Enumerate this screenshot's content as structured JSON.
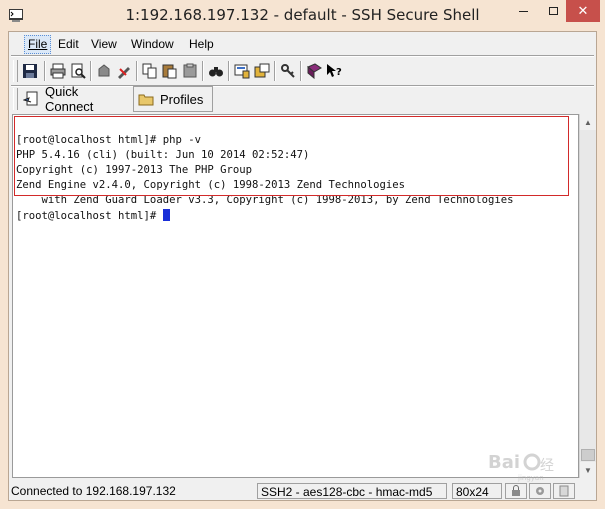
{
  "window": {
    "title": "1:192.168.197.132 - default - SSH Secure Shell",
    "app_icon": "ssh-shell-icon"
  },
  "menu": {
    "file": "File",
    "edit": "Edit",
    "view": "View",
    "window": "Window",
    "help": "Help"
  },
  "toolbar": {
    "icons": [
      "save-icon",
      "print-icon",
      "print-preview-icon",
      "disconnect-icon",
      "new-connection-icon",
      "copy-icon",
      "paste-icon",
      "paste-icon-2",
      "find-icon",
      "settings-icon",
      "sftp-icon",
      "keys-icon",
      "help-book-icon",
      "context-help-icon"
    ]
  },
  "quickbar": {
    "quick_connect": "Quick Connect",
    "profiles": "Profiles"
  },
  "terminal": {
    "lines": [
      "[root@localhost html]# php -v",
      "PHP 5.4.16 (cli) (built: Jun 10 2014 02:52:47)",
      "Copyright (c) 1997-2013 The PHP Group",
      "Zend Engine v2.4.0, Copyright (c) 1998-2013 Zend Technologies",
      "    with Zend Guard Loader v3.3, Copyright (c) 1998-2013, by Zend Technologies"
    ],
    "prompt": "[root@localhost html]# "
  },
  "status": {
    "connection": "Connected to 192.168.197.132",
    "encryption": "SSH2 - aes128-cbc - hmac-md5",
    "size": "80x24"
  },
  "colors": {
    "highlight_border": "#d22a2a",
    "cursor": "#1a2fd8",
    "close_button": "#c7504b"
  }
}
